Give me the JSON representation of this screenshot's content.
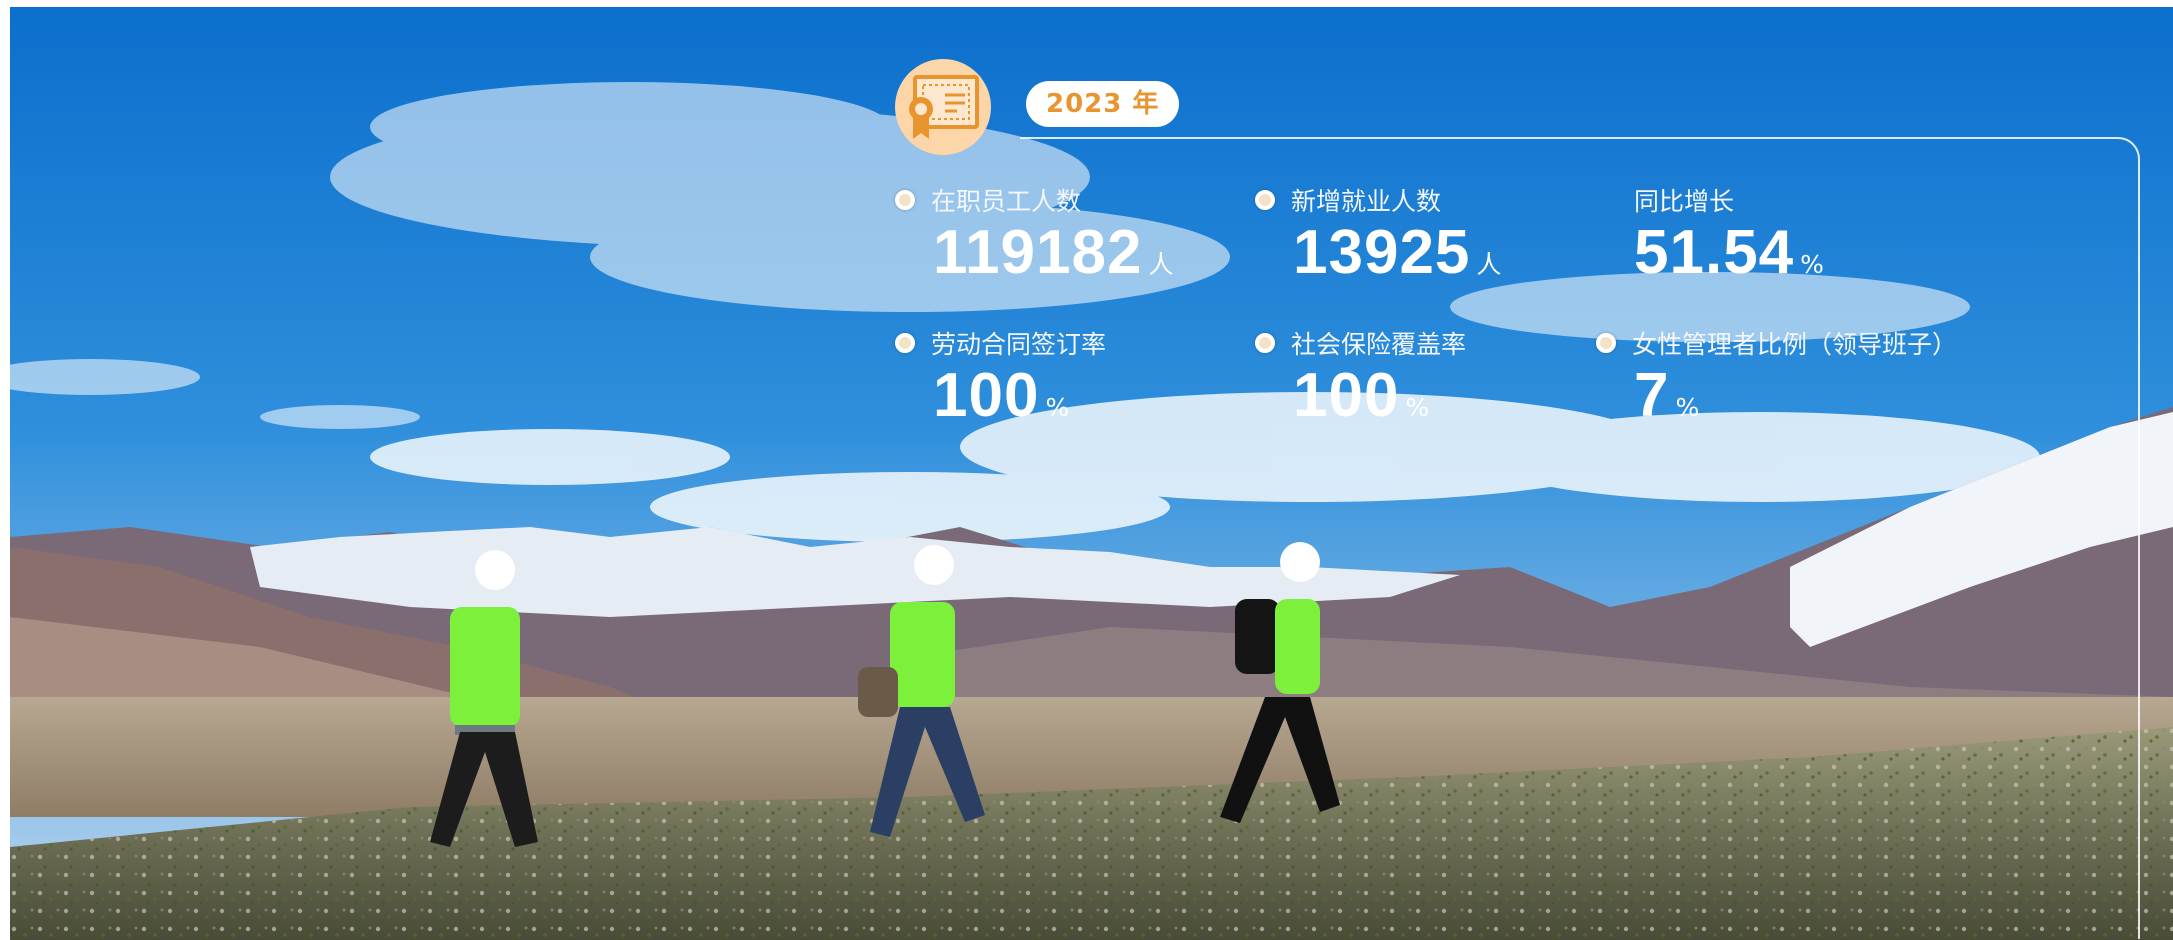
{
  "year_badge": "2023 年",
  "icons": {
    "badge": "certificate-icon",
    "bullet": "bullet-dot-icon"
  },
  "colors": {
    "accent": "#e8952f",
    "badge_circle": "#fcd5a8",
    "bullet_fill": "#f3e3c6",
    "text": "#ffffff"
  },
  "stats": [
    {
      "label": "在职员工人数",
      "value": "119182",
      "unit": "人"
    },
    {
      "label": "新增就业人数",
      "value": "13925",
      "unit": "人"
    },
    {
      "label": "同比增长",
      "value": "51.54",
      "unit": "%"
    },
    {
      "label": "劳动合同签订率",
      "value": "100",
      "unit": "%"
    },
    {
      "label": "社会保险覆盖率",
      "value": "100",
      "unit": "%"
    },
    {
      "label": "女性管理者比例（领导班子）",
      "value": "7",
      "unit": "%"
    }
  ]
}
